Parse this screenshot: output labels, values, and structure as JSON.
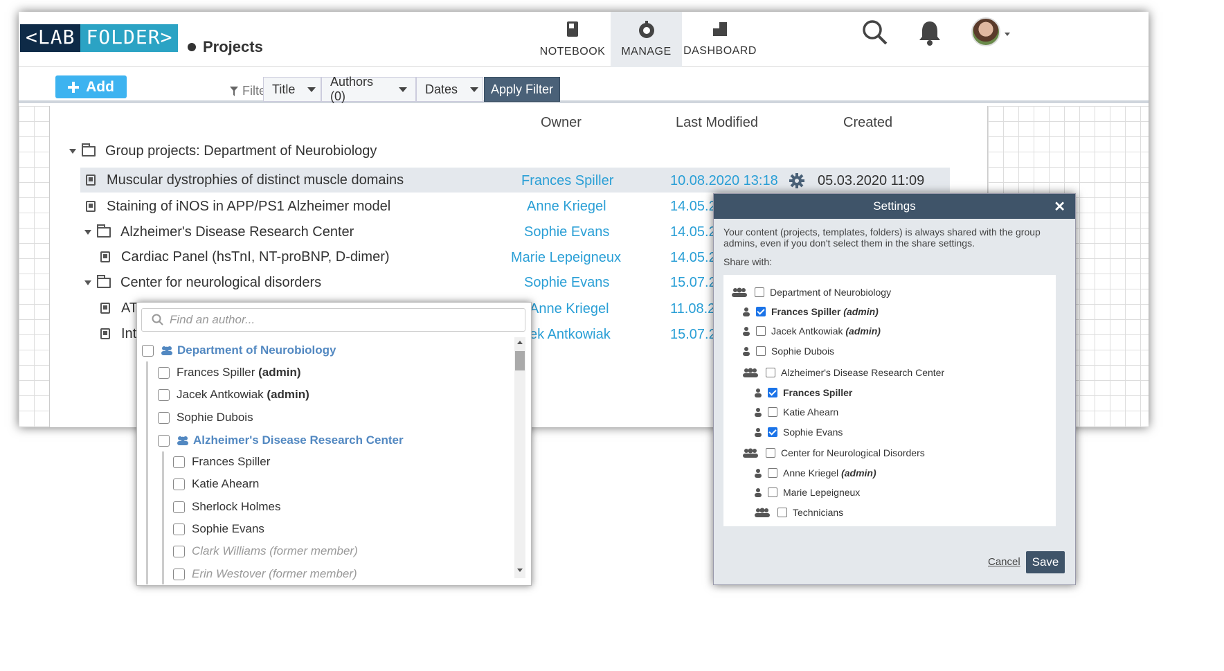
{
  "header": {
    "logo_left": "<LAB",
    "logo_right": "FOLDER>",
    "page_title": "Projects",
    "nav": [
      {
        "label": "NOTEBOOK",
        "icon": "notebook-icon"
      },
      {
        "label": "MANAGE",
        "icon": "manage-icon",
        "active": true
      },
      {
        "label": "DASHBOARD",
        "icon": "dashboard-icon"
      }
    ]
  },
  "toolbar": {
    "add_label": "Add",
    "filter_label": "Filter:",
    "filters": [
      "Title",
      "Authors (0)",
      "Dates"
    ],
    "apply_label": "Apply Filter"
  },
  "table": {
    "columns": [
      "Owner",
      "Last Modified",
      "Created"
    ],
    "group_title": "Group projects: Department of Neurobiology",
    "rows": [
      {
        "title": "Muscular dystrophies of distinct muscle domains",
        "owner": "Frances Spiller",
        "modified": "10.08.2020 13:18",
        "created": "05.03.2020 11:09"
      },
      {
        "title": "Staining of iNOS in APP/PS1 Alzheimer model",
        "owner": "Anne Kriegel",
        "modified": "14.05.2"
      },
      {
        "title": "Alzheimer's Disease Research Center",
        "owner": "Sophie Evans",
        "modified": "14.05.2"
      },
      {
        "title": "Cardiac Panel (hsTnI, NT-proBNP, D-dimer)",
        "owner": "Marie Lepeigneux",
        "modified": "14.05.2"
      },
      {
        "title": "Center for neurological disorders",
        "owner": "Sophie Evans",
        "modified": "15.07.2"
      },
      {
        "title": "AT",
        "owner": "Anne Kriegel",
        "modified": "11.08.2"
      },
      {
        "title": "Int",
        "owner": "ek Antkowiak",
        "modified": "15.07.2"
      }
    ]
  },
  "author_dropdown": {
    "placeholder": "Find an author...",
    "items": [
      {
        "label": "Department of Neurobiology",
        "type": "group"
      },
      {
        "label": "Frances Spiller",
        "suffix": "(admin)"
      },
      {
        "label": "Jacek Antkowiak",
        "suffix": "(admin)"
      },
      {
        "label": "Sophie Dubois"
      },
      {
        "label": "Alzheimer's Disease Research Center",
        "type": "group"
      },
      {
        "label": "Frances Spiller"
      },
      {
        "label": "Katie Ahearn"
      },
      {
        "label": "Sherlock Holmes"
      },
      {
        "label": "Sophie Evans"
      },
      {
        "label": "Clark Williams (former member)",
        "type": "former"
      },
      {
        "label": "Erin Westover (former member)",
        "type": "former"
      }
    ]
  },
  "settings_modal": {
    "title": "Settings",
    "close": "✕",
    "description": "Your content (projects, templates, folders) is always shared with the group admins, even if you don't select them in the share settings.",
    "share_with": "Share with:",
    "items": [
      {
        "label": "Department of Neurobiology",
        "type": "group",
        "checked": false
      },
      {
        "label": "Frances Spiller",
        "suffix": "(admin)",
        "checked": true
      },
      {
        "label": "Jacek Antkowiak",
        "suffix": "(admin)",
        "checked": false
      },
      {
        "label": "Sophie Dubois",
        "checked": false
      },
      {
        "label": "Alzheimer's Disease Research Center",
        "type": "group",
        "checked": false
      },
      {
        "label": "Frances Spiller",
        "checked": true
      },
      {
        "label": "Katie Ahearn",
        "checked": false
      },
      {
        "label": "Sophie Evans",
        "checked": true
      },
      {
        "label": "Center for Neurological Disorders",
        "type": "group",
        "checked": false
      },
      {
        "label": "Anne Kriegel",
        "suffix": "(admin)",
        "checked": false
      },
      {
        "label": "Marie Lepeigneux",
        "checked": false
      },
      {
        "label": "Technicians",
        "type": "group",
        "checked": false
      }
    ],
    "cancel_label": "Cancel",
    "save_label": "Save"
  },
  "colors": {
    "accent": "#2a9fd6",
    "header_dark": "#3f5469",
    "add_button": "#3db3f0"
  }
}
